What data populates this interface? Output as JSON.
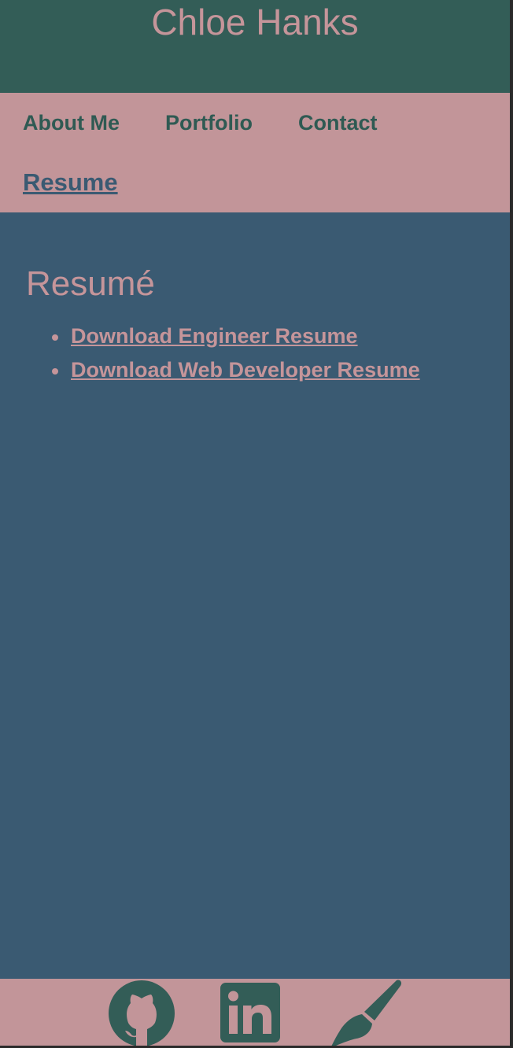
{
  "header": {
    "site_title": "Chloe Hanks"
  },
  "nav": {
    "items": [
      {
        "label": "About Me"
      },
      {
        "label": "Portfolio"
      },
      {
        "label": "Contact"
      },
      {
        "label": "Resume",
        "active": true
      }
    ]
  },
  "main": {
    "title": "Resumé",
    "links": [
      {
        "label": "Download Engineer Resume"
      },
      {
        "label": "Download Web Developer Resume"
      }
    ]
  },
  "footer": {
    "icons": [
      "github-icon",
      "linkedin-icon",
      "paintbrush-icon"
    ]
  },
  "colors": {
    "header_bg": "#335d57",
    "nav_bg": "#c29599",
    "main_bg": "#3a5a72",
    "accent_pink": "#c5959a",
    "accent_green": "#2f5a53"
  }
}
